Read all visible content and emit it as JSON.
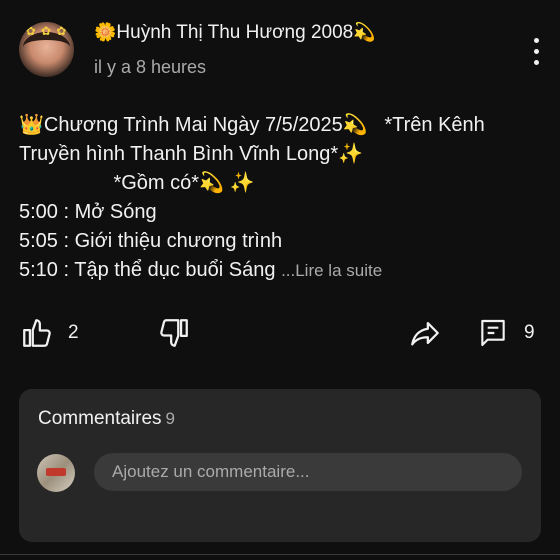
{
  "post": {
    "author": "Huỳnh Thị Thu Hương 2008",
    "author_prefix_emoji": "🌼",
    "author_suffix_emoji": "💫",
    "time": "il y a 8 heures",
    "lines": [
      "👑Chương Trình Mai Ngày 7/5/2025💫   *Trên Kênh",
      "Truyền hình Thanh Bình Vĩnh Long*✨",
      "                 *Gồm có*💫 ✨",
      "5:00 : Mở Sóng",
      "5:05 : Giới thiệu chương trình",
      "5:10 : Tập thể dục buổi Sáng "
    ],
    "read_more": "...Lire la suite"
  },
  "actions": {
    "like_count": "2",
    "comment_count": "9"
  },
  "comments": {
    "title": "Commentaires",
    "count": "9",
    "input_placeholder": "Ajoutez un commentaire..."
  },
  "icons": {
    "menu": "more-vert-icon",
    "like": "thumb-up-icon",
    "dislike": "thumb-down-icon",
    "share": "share-icon",
    "comment": "comment-icon"
  },
  "colors": {
    "background": "#0f0f0f",
    "card": "#272727",
    "text": "#f1f1f1",
    "secondary_text": "#aaaaaa"
  }
}
